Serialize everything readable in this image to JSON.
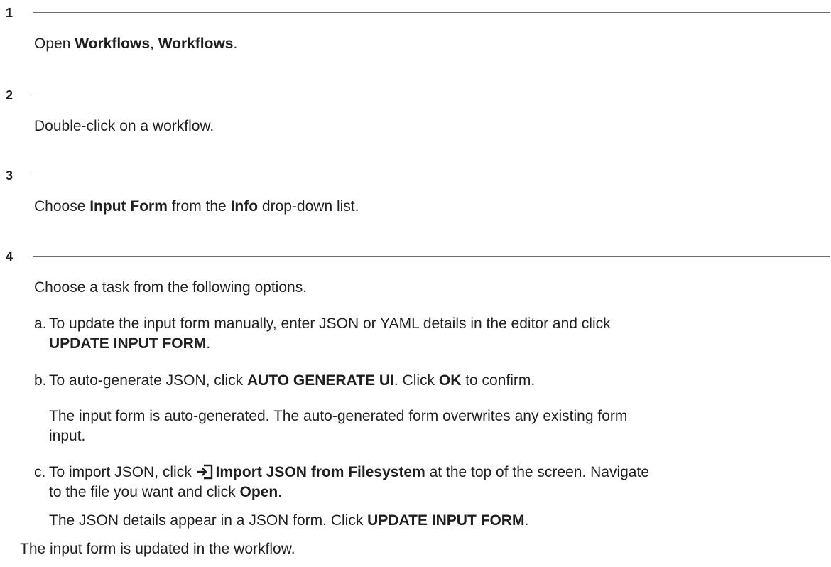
{
  "steps": [
    {
      "number": "1",
      "parts": [
        "Open ",
        "Workflows",
        ", ",
        "Workflows",
        "."
      ]
    },
    {
      "number": "2",
      "text": "Double-click on a workflow."
    },
    {
      "number": "3",
      "parts": [
        "Choose ",
        "Input Form",
        " from the ",
        "Info",
        " drop-down list."
      ]
    },
    {
      "number": "4",
      "intro": "Choose a task from the following options.",
      "options": {
        "a": {
          "label": "a.",
          "line1": "To update the input form manually, enter JSON or YAML details in the editor and click",
          "line2_bold": "UPDATE INPUT FORM",
          "line2_end": "."
        },
        "b": {
          "label": "b.",
          "t1": "To auto-generate JSON, click ",
          "b1": "AUTO GENERATE UI",
          "t2": ". Click ",
          "b2": "OK",
          "t3": " to confirm.",
          "note_line1": "The input form is auto-generated. The auto-generated form overwrites any existing form",
          "note_line2": "input."
        },
        "c": {
          "label": "c.",
          "t1": "To import JSON, click ",
          "icon": "import-icon",
          "b1": "Import JSON from Filesystem",
          "t2": " at the top of the screen. Navigate",
          "line2_t": "to the file you want and click ",
          "line2_b": "Open",
          "line2_end": ".",
          "note_t": "The JSON details appear in a JSON form. Click ",
          "note_b": "UPDATE INPUT FORM",
          "note_end": "."
        }
      }
    }
  ],
  "result": "The input form is updated in the workflow."
}
